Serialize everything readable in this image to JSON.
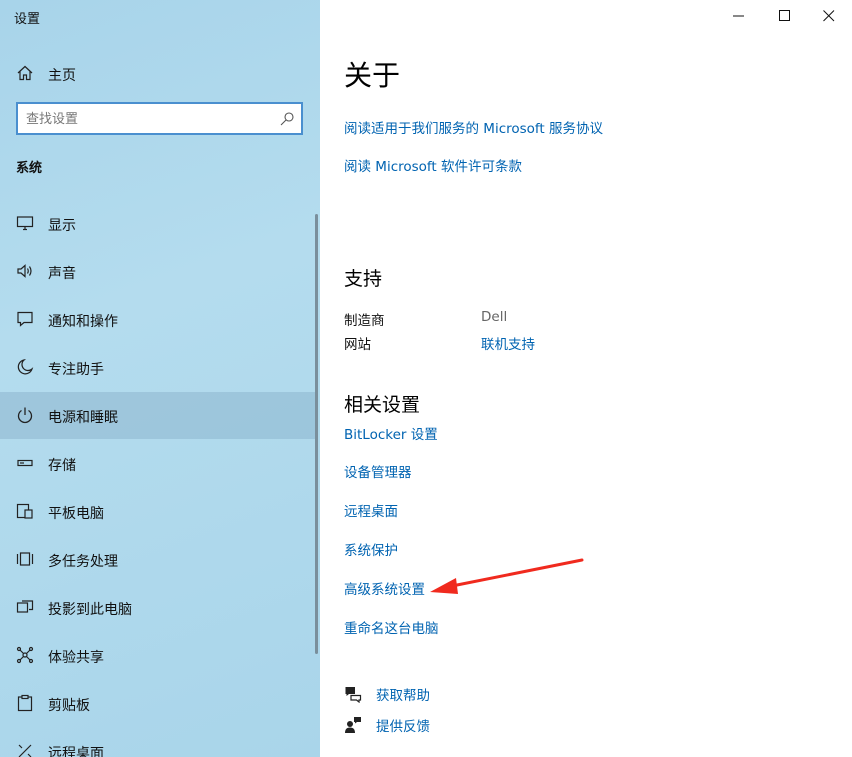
{
  "window": {
    "title": "设置"
  },
  "sidebar": {
    "home_label": "主页",
    "search_placeholder": "查找设置",
    "section": "系统",
    "items": [
      {
        "label": "显示",
        "icon": "display-icon"
      },
      {
        "label": "声音",
        "icon": "speaker-icon"
      },
      {
        "label": "通知和操作",
        "icon": "notification-icon"
      },
      {
        "label": "专注助手",
        "icon": "moon-icon"
      },
      {
        "label": "电源和睡眠",
        "icon": "power-icon",
        "active": true
      },
      {
        "label": "存储",
        "icon": "storage-icon"
      },
      {
        "label": "平板电脑",
        "icon": "tablet-icon"
      },
      {
        "label": "多任务处理",
        "icon": "multitask-icon"
      },
      {
        "label": "投影到此电脑",
        "icon": "project-icon"
      },
      {
        "label": "体验共享",
        "icon": "share-icon"
      },
      {
        "label": "剪贴板",
        "icon": "clipboard-icon"
      },
      {
        "label": "远程桌面",
        "icon": "remote-icon"
      }
    ]
  },
  "main": {
    "about_title": "关于",
    "about_links": [
      "阅读适用于我们服务的 Microsoft 服务协议",
      "阅读 Microsoft 软件许可条款"
    ],
    "support_title": "支持",
    "support": {
      "manufacturer_label": "制造商",
      "manufacturer_value": "Dell",
      "website_label": "网站",
      "website_value": "联机支持"
    },
    "related_title": "相关设置",
    "related_links": [
      "BitLocker 设置",
      "设备管理器",
      "远程桌面",
      "系统保护",
      "高级系统设置",
      "重命名这台电脑"
    ],
    "help": {
      "get_help": "获取帮助",
      "feedback": "提供反馈"
    }
  },
  "colors": {
    "accent": "#0063b1",
    "sidebar_bg": "#a8d4ea",
    "annotation_arrow": "#f02a1e"
  }
}
